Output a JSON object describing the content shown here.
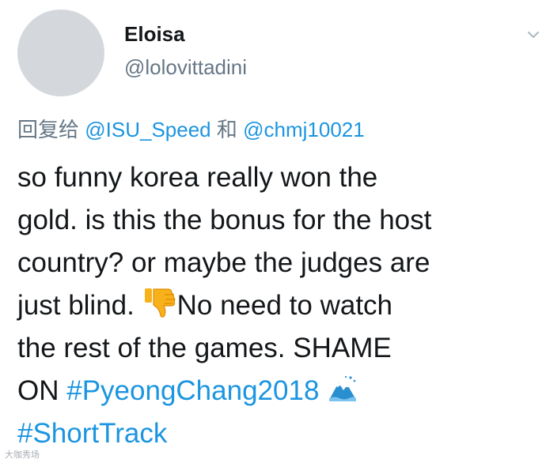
{
  "user": {
    "display_name": "Eloisa",
    "handle": "@lolovittadini"
  },
  "reply": {
    "prefix": "回复给",
    "mention_1": "@ISU_Speed",
    "conjunction": "和",
    "mention_2": "@chmj10021"
  },
  "body": {
    "line_1": "so funny korea really won the",
    "line_2": "gold. is this the bonus for the host",
    "line_3": "country? or maybe the judges are",
    "line_4_a": "just blind.",
    "line_4_b": "No need to watch",
    "line_5": "the rest of the games. SHAME",
    "line_6_a": "ON",
    "hashtag_1": "#PyeongChang2018",
    "hashtag_2": "#ShortTrack"
  },
  "icons": {
    "menu": "chevron-down-icon",
    "emoji_1": "thumbs-down-emoji-icon",
    "emoji_2": "snowy-mountain-icon"
  },
  "watermark": "大咖秀场",
  "colors": {
    "link": "#1b95e0",
    "text": "#14171a",
    "secondary": "#657786",
    "avatar": "#d4d8dd"
  }
}
